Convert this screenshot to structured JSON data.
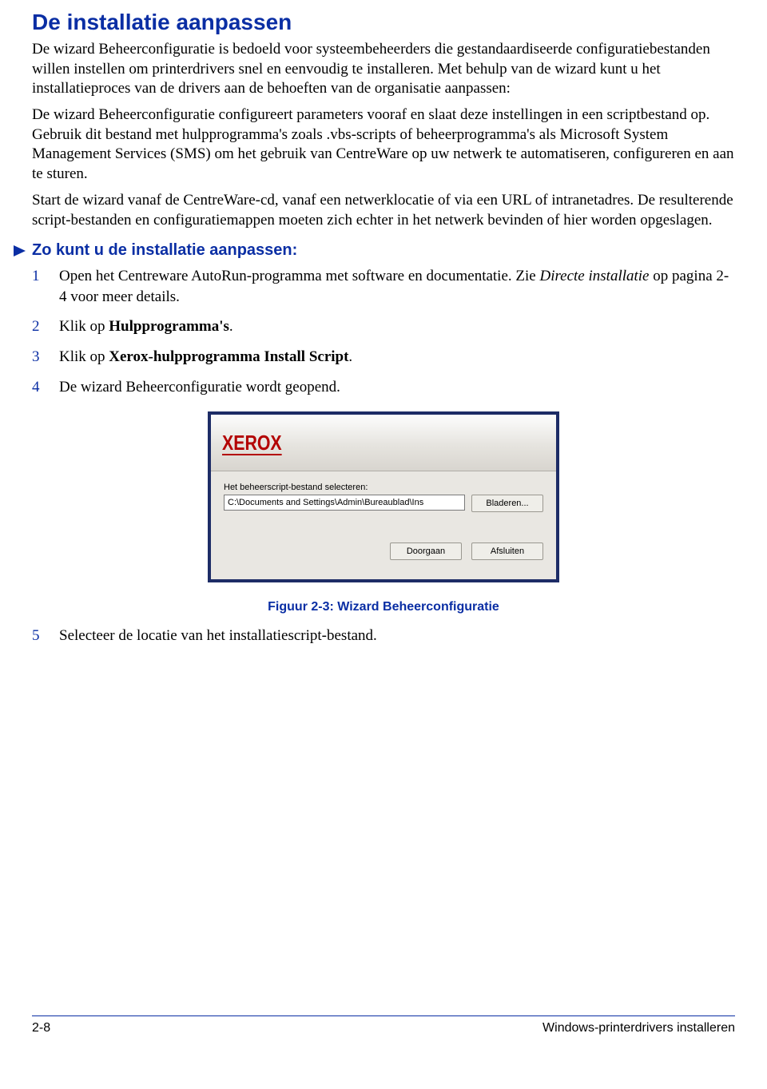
{
  "title": "De installatie aanpassen",
  "intro": "De wizard Beheerconfiguratie is bedoeld voor systeembeheerders die gestandaardiseerde configuratiebestanden willen instellen om printerdrivers snel en eenvoudig te installeren. Met behulp van de wizard kunt u het installatieproces van de drivers aan de behoeften van de organisatie aanpassen:",
  "para2": "De wizard Beheerconfiguratie configureert parameters vooraf en slaat deze instellingen in een scriptbestand op. Gebruik dit bestand met hulpprogramma's zoals .vbs-scripts of beheerprogramma's als Microsoft System Management Services (SMS) om het gebruik van CentreWare op uw netwerk te automatiseren, configureren en aan te sturen.",
  "para3": "Start de wizard vanaf de CentreWare-cd, vanaf een netwerklocatie of via een URL of intranetadres. De resulterende script-bestanden en configuratiemappen moeten zich echter in het netwerk bevinden of hier worden opgeslagen.",
  "sub_heading": "Zo kunt u de installatie aanpassen:",
  "steps": {
    "s1a": "Open het Centreware AutoRun-programma met software en documentatie. Zie ",
    "s1b": "Directe installatie",
    "s1c": " op pagina 2-4 voor meer details.",
    "s2a": "Klik op ",
    "s2b": "Hulpprogramma's",
    "s2c": ".",
    "s3a": "Klik op ",
    "s3b": "Xerox-hulpprogramma Install Script",
    "s3c": ".",
    "s4": "De wizard Beheerconfiguratie wordt geopend.",
    "s5": "Selecteer de locatie van het installatiescript-bestand."
  },
  "dialog": {
    "logo": "XEROX",
    "label": "Het beheerscript-bestand selecteren:",
    "path": "C:\\Documents and Settings\\Admin\\Bureaublad\\Ins",
    "browse": "Bladeren...",
    "continue": "Doorgaan",
    "close": "Afsluiten"
  },
  "caption": "Figuur 2-3: Wizard Beheerconfiguratie",
  "footer": {
    "left": "2-8",
    "right": "Windows-printerdrivers installeren"
  }
}
